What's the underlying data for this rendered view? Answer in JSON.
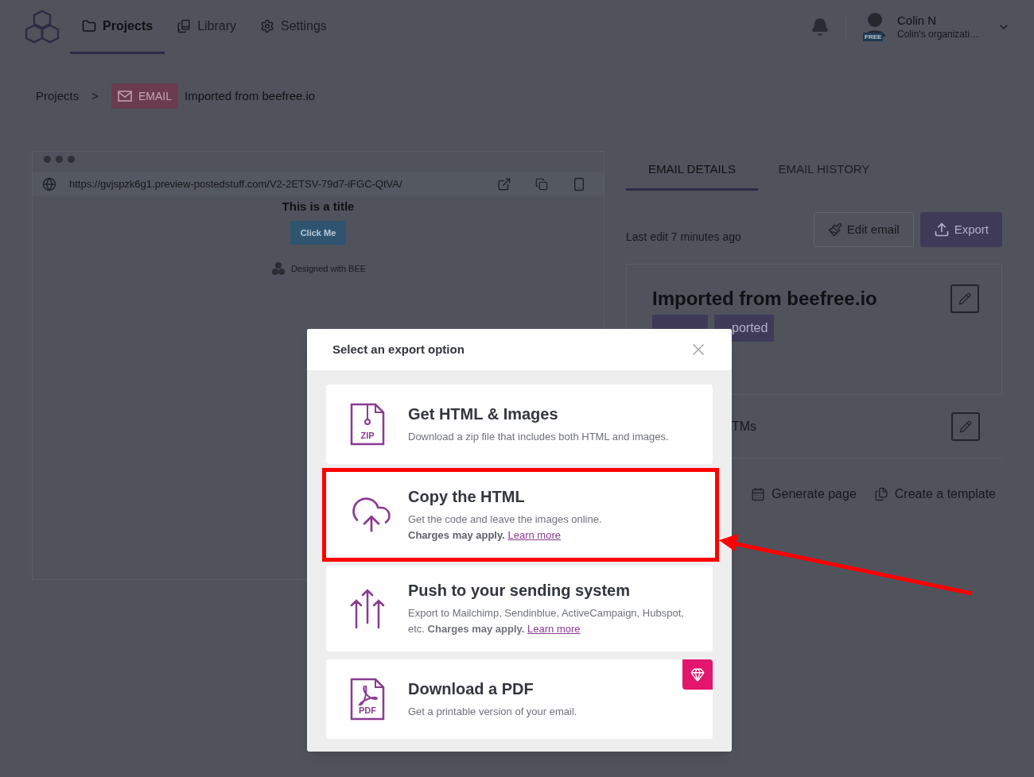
{
  "header": {
    "nav": [
      {
        "label": "Projects",
        "selected": true
      },
      {
        "label": "Library",
        "selected": false
      },
      {
        "label": "Settings",
        "selected": false
      }
    ],
    "user": {
      "name": "Colin N",
      "organization": "Colin's organizati…",
      "plan": "FREE"
    }
  },
  "breadcrumb": {
    "root": "Projects",
    "separator": ">",
    "type_tag": "EMAIL",
    "current": "Imported from beefree.io"
  },
  "preview": {
    "url": "https://gvjspzk6g1.preview-postedstuff.com/V2-2ETSV-79d7-iFGC-QtVA/",
    "title": "This is a title",
    "button": "Click Me",
    "footer": "Designed with BEE"
  },
  "details": {
    "tabs": [
      {
        "label": "EMAIL DETAILS",
        "selected": true
      },
      {
        "label": "EMAIL HISTORY",
        "selected": false
      }
    ],
    "last_edit": "Last edit 7 minutes ago",
    "edit_button": "Edit email",
    "export_button": "Export",
    "card": {
      "title": "Imported from beefree.io",
      "tag": "ported"
    },
    "utm_label": "TMs",
    "actions": [
      "Generate page",
      "Create a template"
    ]
  },
  "modal": {
    "title": "Select an export option",
    "options": [
      {
        "kind": "zip",
        "icon_label": "ZIP",
        "title": "Get HTML & Images",
        "description": "Download a zip file that includes both HTML and images.",
        "highlighted": false,
        "premium": false
      },
      {
        "kind": "cloud",
        "title": "Copy the HTML",
        "description": "Get the code and leave the images online.",
        "note": "Charges may apply.",
        "link": "Learn more",
        "highlighted": true,
        "premium": false
      },
      {
        "kind": "push",
        "title": "Push to your sending system",
        "description": "Export to Mailchimp, Sendinblue, ActiveCampaign, Hubspot, etc. **Charges may apply.**",
        "link": "Learn more",
        "highlighted": false,
        "premium": false
      },
      {
        "kind": "pdf",
        "icon_label": "PDF",
        "title": "Download a PDF",
        "description": "Get a printable version of your email.",
        "highlighted": false,
        "premium": true
      }
    ]
  }
}
